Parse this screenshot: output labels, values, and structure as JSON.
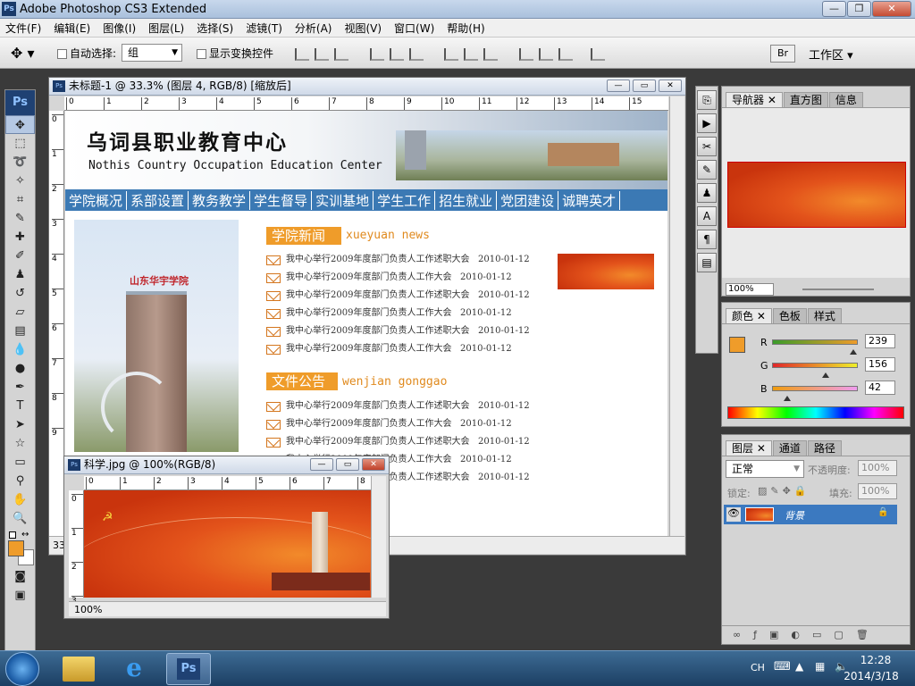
{
  "app": {
    "title": "Adobe Photoshop CS3 Extended",
    "ps_badge": "Ps"
  },
  "menu": [
    "文件(F)",
    "编辑(E)",
    "图像(I)",
    "图层(L)",
    "选择(S)",
    "滤镜(T)",
    "分析(A)",
    "视图(V)",
    "窗口(W)",
    "帮助(H)"
  ],
  "options": {
    "auto_select_label": "自动选择:",
    "auto_select_value": "组",
    "show_transform_label": "显示变换控件",
    "workspace_label": "工作区 ▾"
  },
  "doc1": {
    "title": "未标题-1 @ 33.3% (图层 4, RGB/8) [缩放后]",
    "ruler_h": [
      "0",
      "1",
      "2",
      "3",
      "4",
      "5",
      "6",
      "7",
      "8",
      "9",
      "10",
      "11",
      "12",
      "13",
      "14",
      "15"
    ],
    "ruler_v": [
      "0",
      "1",
      "2",
      "3",
      "4",
      "5",
      "6",
      "7",
      "8",
      "9"
    ],
    "zoom": "33",
    "page": {
      "cn_title": "乌词县职业教育中心",
      "en_title": "Nothis Country Occupation Education Center",
      "nav": [
        "学院概况",
        "系部设置",
        "教务教学",
        "学生督导",
        "实训基地",
        "学生工作",
        "招生就业",
        "党团建设",
        "诚聘英才"
      ],
      "building_sign": "山东华宇学院",
      "news_title": "学院新闻",
      "news_pinyin": "xueyuan news",
      "news": [
        {
          "text": "我中心举行2009年度部门负责人工作述职大会",
          "date": "2010-01-12"
        },
        {
          "text": "我中心举行2009年度部门负责人工作大会",
          "date": "2010-01-12"
        },
        {
          "text": "我中心举行2009年度部门负责人工作述职大会",
          "date": "2010-01-12"
        },
        {
          "text": "我中心举行2009年度部门负责人工作大会",
          "date": "2010-01-12"
        },
        {
          "text": "我中心举行2009年度部门负责人工作述职大会",
          "date": "2010-01-12"
        },
        {
          "text": "我中心举行2009年度部门负责人工作大会",
          "date": "2010-01-12"
        }
      ],
      "notice_title": "文件公告",
      "notice_pinyin": "wenjian gonggao",
      "notices": [
        {
          "text": "我中心举行2009年度部门负责人工作述职大会",
          "date": "2010-01-12"
        },
        {
          "text": "我中心举行2009年度部门负责人工作大会",
          "date": "2010-01-12"
        },
        {
          "text": "我中心举行2009年度部门负责人工作述职大会",
          "date": "2010-01-12"
        },
        {
          "text": "我中心举行2009年度部门负责人工作大会",
          "date": "2010-01-12"
        },
        {
          "text": "我中心举行2009年度部门负责人工作述职大会",
          "date": "2010-01-12"
        }
      ]
    }
  },
  "doc2": {
    "title": "科学.jpg @ 100%(RGB/8)",
    "ruler_h": [
      "0",
      "1",
      "2",
      "3",
      "4",
      "5",
      "6",
      "7",
      "8"
    ],
    "ruler_v": [
      "0",
      "1",
      "2",
      "3"
    ],
    "zoom": "100%"
  },
  "navigator": {
    "tabs": [
      "导航器",
      "直方图",
      "信息"
    ],
    "zoom": "100%"
  },
  "color": {
    "tabs": [
      "颜色",
      "色板",
      "样式"
    ],
    "r_label": "R",
    "g_label": "G",
    "b_label": "B",
    "r": "239",
    "g": "156",
    "b": "42",
    "r_frac": 0.937,
    "g_frac": 0.612,
    "b_frac": 0.165,
    "fg": "#ef9c2a"
  },
  "layers": {
    "tabs": [
      "图层",
      "通道",
      "路径"
    ],
    "blend": "正常",
    "opacity_label": "不透明度:",
    "opacity": "100%",
    "lock_label": "锁定:",
    "fill_label": "填充:",
    "fill": "100%",
    "layer_name": "背景"
  },
  "taskbar": {
    "lang": "CH",
    "time": "12:28",
    "date": "2014/3/18"
  },
  "colors": {
    "accent": "#3b79c0",
    "orange": "#ef9c2a",
    "nav_blue": "#3b79b4"
  }
}
